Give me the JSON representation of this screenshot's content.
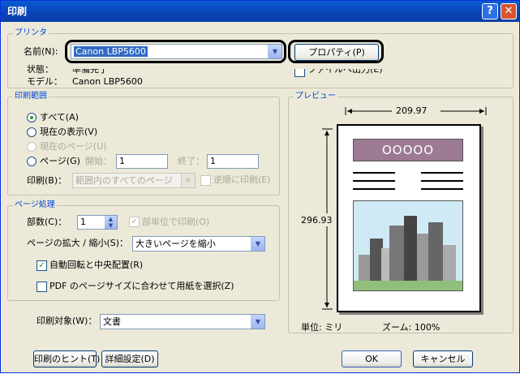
{
  "window": {
    "title": "印刷"
  },
  "printer": {
    "group_label": "プリンタ",
    "name_label": "名前(N):",
    "name_value": "Canon LBP5600",
    "properties_button": "プロパティ(P)",
    "status_label": "状態：",
    "status_value": "準備完了",
    "model_label": "モデル：",
    "model_value": "Canon LBP5600",
    "print_to_file": "ファイルへ出力(E)"
  },
  "print_range": {
    "group_label": "印刷範囲",
    "all": "すべて(A)",
    "current_view": "現在の表示(V)",
    "current_page": "現在のページ(U)",
    "pages": "ページ(G)",
    "start_label": "開始：",
    "start_value": "1",
    "end_label": "終了：",
    "end_value": "1",
    "print_label": "印刷(B)：",
    "print_value": "範囲内のすべてのページ",
    "reverse": "逆順に印刷(E)"
  },
  "page_handling": {
    "group_label": "ページ処理",
    "copies_label": "部数(C)：",
    "copies_value": "1",
    "collate": "部単位で印刷(O)",
    "scaling_label": "ページの拡大 / 縮小(S)：",
    "scaling_value": "大きいページを縮小",
    "auto_rotate": "自動回転と中央配置(R)",
    "choose_paper": "PDF のページサイズに合わせて用紙を選択(Z)"
  },
  "print_what": {
    "label": "印刷対象(W)：",
    "value": "文書"
  },
  "preview": {
    "group_label": "プレビュー",
    "width": "209.97",
    "height": "296.93",
    "units": "単位: ミリ",
    "zoom": "ズーム: 100%",
    "sample_text": "OOOOO"
  },
  "buttons": {
    "hints": "印刷のヒント(T)",
    "advanced": "詳細設定(D)",
    "ok": "OK",
    "cancel": "キャンセル"
  },
  "colors": {
    "title_bar": "#0842b3",
    "group_label": "#0046d5",
    "preview_header": "#9c7a93",
    "preview_sky": "#cfeaf5"
  }
}
